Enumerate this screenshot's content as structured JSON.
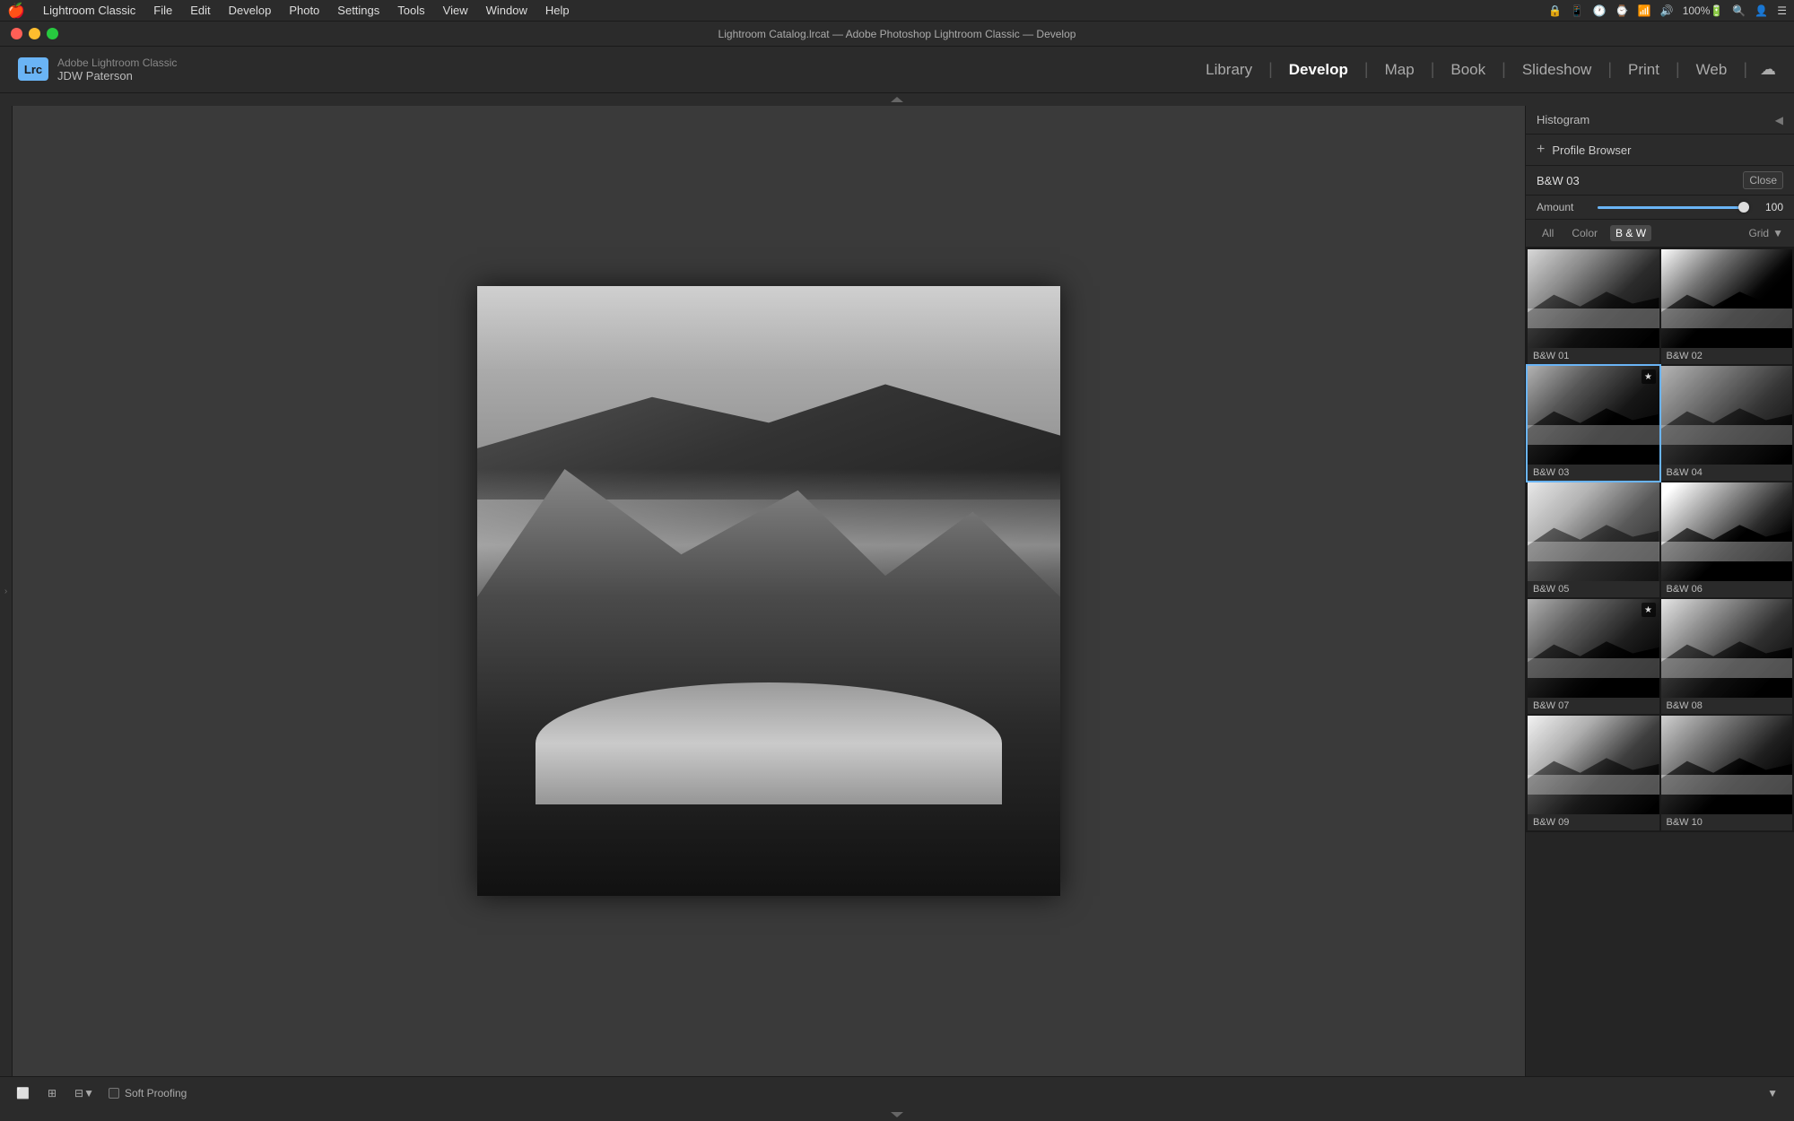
{
  "menubar": {
    "apple": "🍎",
    "app_name": "Lightroom Classic",
    "menus": [
      "File",
      "Edit",
      "Develop",
      "Photo",
      "Settings",
      "Tools",
      "View",
      "Window",
      "Help"
    ],
    "right_items": [
      "🔒",
      "📱",
      "🕐",
      "⌚",
      "📶",
      "🔊",
      "100%",
      "🔋"
    ]
  },
  "titlebar": {
    "title": "Lightroom Catalog.lrcat — Adobe Photoshop Lightroom Classic — Develop"
  },
  "header": {
    "lrc_badge": "Lrc",
    "app_name": "Adobe Lightroom Classic",
    "user_name": "JDW Paterson",
    "nav": {
      "items": [
        "Library",
        "Develop",
        "Map",
        "Book",
        "Slideshow",
        "Print",
        "Web"
      ],
      "active": "Develop",
      "separators": [
        "|",
        "|",
        "|",
        "|",
        "|",
        "|"
      ]
    }
  },
  "right_panel": {
    "histogram_label": "Histogram",
    "profile_browser": {
      "title": "Profile Browser",
      "plus_label": "+",
      "current_profile": "B&W 03",
      "close_label": "Close",
      "amount_label": "Amount",
      "amount_value": "100",
      "filter_tabs": [
        "All",
        "Color",
        "B & W"
      ],
      "active_filter": "B & W",
      "grid_label": "Grid",
      "profiles": [
        {
          "id": "bw01",
          "label": "B&W 01",
          "selected": false,
          "starred": false,
          "thumb_class": "thumb-bw01"
        },
        {
          "id": "bw02",
          "label": "B&W 02",
          "selected": false,
          "starred": false,
          "thumb_class": "thumb-bw02"
        },
        {
          "id": "bw03",
          "label": "B&W 03",
          "selected": true,
          "starred": true,
          "thumb_class": "thumb-bw03"
        },
        {
          "id": "bw04",
          "label": "B&W 04",
          "selected": false,
          "starred": false,
          "thumb_class": "thumb-bw04"
        },
        {
          "id": "bw05",
          "label": "B&W 05",
          "selected": false,
          "starred": false,
          "thumb_class": "thumb-bw05"
        },
        {
          "id": "bw06",
          "label": "B&W 06",
          "selected": false,
          "starred": false,
          "thumb_class": "thumb-bw06"
        },
        {
          "id": "bw07",
          "label": "B&W 07",
          "selected": false,
          "starred": true,
          "thumb_class": "thumb-bw07"
        },
        {
          "id": "bw08",
          "label": "B&W 08",
          "selected": false,
          "starred": false,
          "thumb_class": "thumb-bw08"
        },
        {
          "id": "bw09",
          "label": "B&W 09",
          "selected": false,
          "starred": false,
          "thumb_class": "thumb-bw09"
        },
        {
          "id": "bw10",
          "label": "B&W 10",
          "selected": false,
          "starred": false,
          "thumb_class": "thumb-bw10"
        }
      ]
    }
  },
  "bottom_toolbar": {
    "view_single": "⬜",
    "view_multi": "⊞",
    "view_compare": "⊟",
    "soft_proofing_label": "Soft Proofing"
  }
}
